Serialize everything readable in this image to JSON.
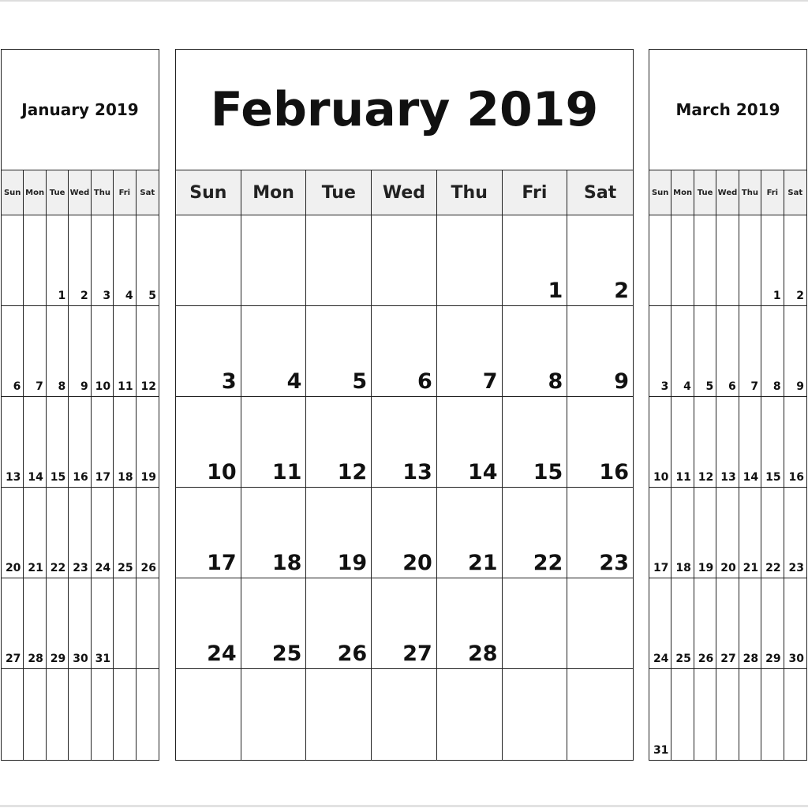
{
  "days": [
    "Sun",
    "Mon",
    "Tue",
    "Wed",
    "Thu",
    "Fri",
    "Sat"
  ],
  "calendars": [
    {
      "title": "January 2019",
      "weeks": [
        [
          "",
          "",
          "1",
          "2",
          "3",
          "4",
          "5"
        ],
        [
          "6",
          "7",
          "8",
          "9",
          "10",
          "11",
          "12"
        ],
        [
          "13",
          "14",
          "15",
          "16",
          "17",
          "18",
          "19"
        ],
        [
          "20",
          "21",
          "22",
          "23",
          "24",
          "25",
          "26"
        ],
        [
          "27",
          "28",
          "29",
          "30",
          "31",
          "",
          ""
        ],
        [
          "",
          "",
          "",
          "",
          "",
          "",
          ""
        ]
      ]
    },
    {
      "title": "February 2019",
      "weeks": [
        [
          "",
          "",
          "",
          "",
          "",
          "1",
          "2"
        ],
        [
          "3",
          "4",
          "5",
          "6",
          "7",
          "8",
          "9"
        ],
        [
          "10",
          "11",
          "12",
          "13",
          "14",
          "15",
          "16"
        ],
        [
          "17",
          "18",
          "19",
          "20",
          "21",
          "22",
          "23"
        ],
        [
          "24",
          "25",
          "26",
          "27",
          "28",
          "",
          ""
        ],
        [
          "",
          "",
          "",
          "",
          "",
          "",
          ""
        ]
      ]
    },
    {
      "title": "March 2019",
      "weeks": [
        [
          "",
          "",
          "",
          "",
          "",
          "1",
          "2"
        ],
        [
          "3",
          "4",
          "5",
          "6",
          "7",
          "8",
          "9"
        ],
        [
          "10",
          "11",
          "12",
          "13",
          "14",
          "15",
          "16"
        ],
        [
          "17",
          "18",
          "19",
          "20",
          "21",
          "22",
          "23"
        ],
        [
          "24",
          "25",
          "26",
          "27",
          "28",
          "29",
          "30"
        ],
        [
          "31",
          "",
          "",
          "",
          "",
          "",
          ""
        ]
      ]
    }
  ]
}
